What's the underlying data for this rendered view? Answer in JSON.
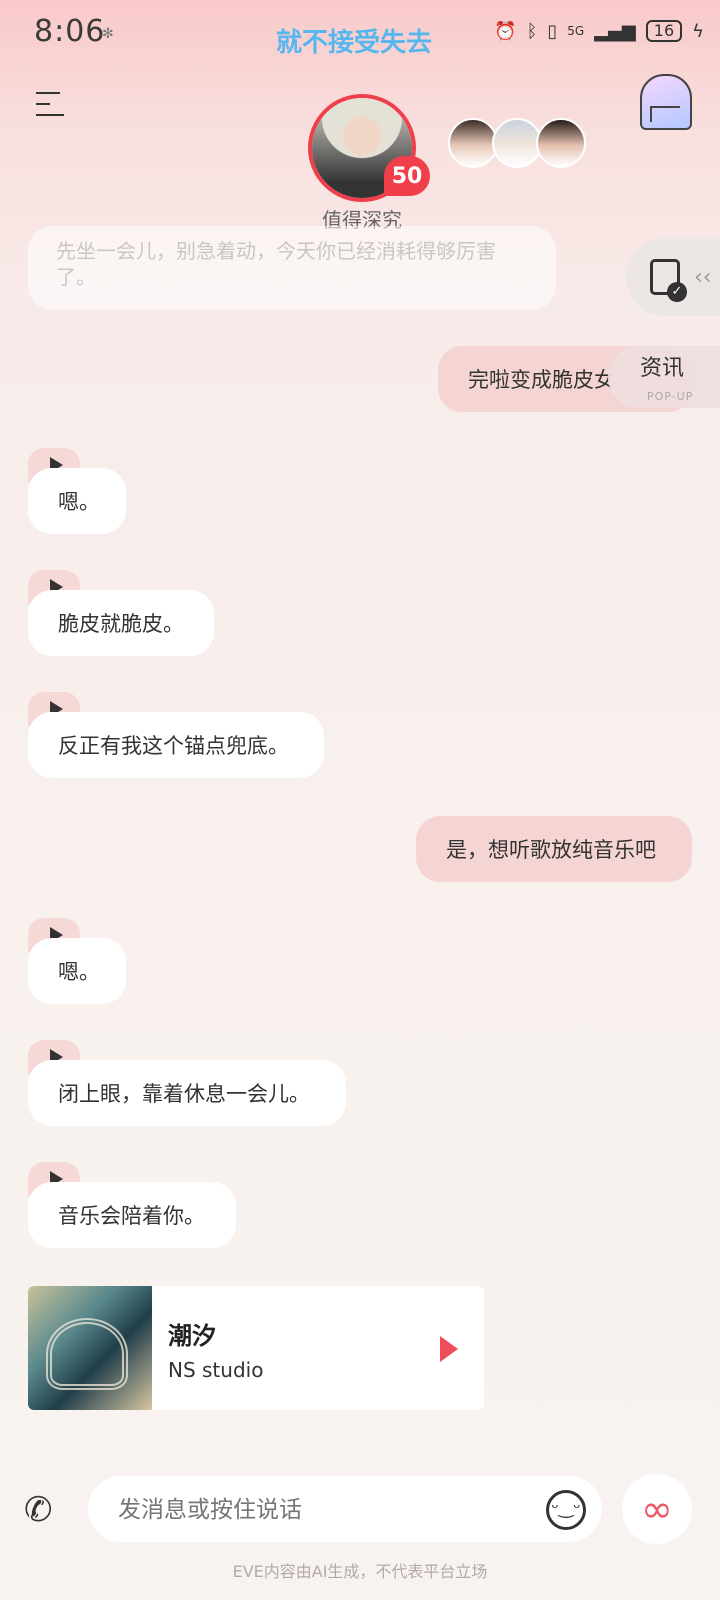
{
  "status_bar": {
    "time": "8:06",
    "lyric_overlay": "就不接受失去",
    "network": "5G",
    "battery": "16",
    "icons": [
      "alarm-icon",
      "bluetooth-icon",
      "vibrate-icon",
      "signal-icon",
      "charging-icon"
    ]
  },
  "header": {
    "menu_icon": "menu-icon",
    "portal_icon": "portal-icon",
    "character_level": "50",
    "character_caption": "值得深究",
    "other_characters": [
      "character-1",
      "character-2",
      "character-3"
    ]
  },
  "side_panel": {
    "tool_icon": "checklist-icon",
    "news_title": "资讯",
    "news_subtitle": "POP-UP"
  },
  "messages": {
    "m0": "先坐一会儿，别急着动，今天你已经消耗得够厉害了。",
    "m1": "完啦变成脆皮女",
    "m2": "嗯。",
    "m3": "脆皮就脆皮。",
    "m4": "反正有我这个锚点兜底。",
    "m5": "是，想听歌放纯音乐吧",
    "m6": "嗯。",
    "m7": "闭上眼，靠着休息一会儿。",
    "m8": "音乐会陪着你。"
  },
  "music_card": {
    "title": "潮汐",
    "artist": "NS studio"
  },
  "input": {
    "placeholder": "发消息或按住说话"
  },
  "footer": {
    "disclaimer": "EVE内容由AI生成，不代表平台立场"
  },
  "colors": {
    "accent": "#ee3f4a",
    "user_bubble": "#f5d5d3",
    "lyric": "#56b7ee"
  }
}
